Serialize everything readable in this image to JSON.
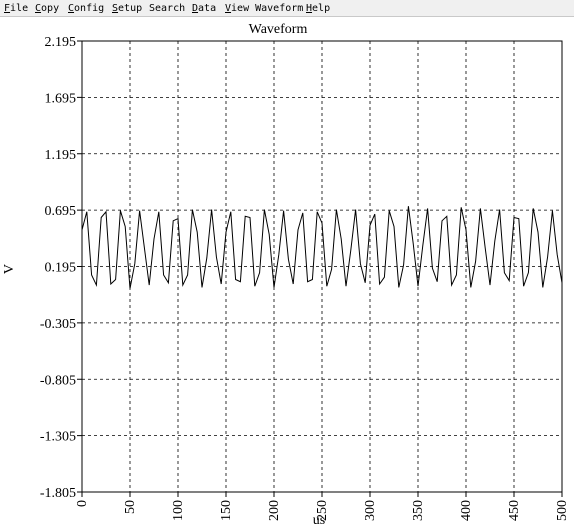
{
  "menu": [
    {
      "mnemonic": "F",
      "rest": "ile"
    },
    {
      "mnemonic": "C",
      "rest": "opy"
    },
    {
      "mnemonic": "C",
      "rest": "onfig",
      "prefix": ""
    },
    {
      "mnemonic": "S",
      "rest": "etup"
    },
    {
      "mnemonic": "",
      "rest": "Search"
    },
    {
      "mnemonic": "D",
      "rest": "ata"
    },
    {
      "mnemonic": "V",
      "rest": "iew Waveform"
    },
    {
      "mnemonic": "H",
      "rest": "elp"
    }
  ],
  "chart_data": {
    "type": "line",
    "title": "Waveform",
    "xlabel": "us",
    "ylabel": "V",
    "xlim": [
      0,
      500
    ],
    "ylim": [
      -1.805,
      2.195
    ],
    "x_ticks": [
      0,
      50,
      100,
      150,
      200,
      250,
      300,
      350,
      400,
      450,
      500
    ],
    "y_ticks": [
      2.195,
      1.695,
      1.195,
      0.695,
      0.195,
      -0.305,
      -0.805,
      -1.305,
      -1.805
    ],
    "y_tick_labels": [
      "2.195",
      "1.695",
      "1.195",
      "0.695",
      "0.195",
      "-0.305",
      "-0.805",
      "-1.305",
      "-1.805"
    ],
    "x_tick_labels": [
      "0",
      "50",
      "100",
      "150",
      "200",
      "250",
      "300",
      "350",
      "400",
      "450",
      "500"
    ],
    "grid": true,
    "series": [
      {
        "color": "#000000",
        "x": [
          0,
          5,
          10,
          15,
          20,
          25,
          30,
          35,
          40,
          45,
          50,
          55,
          60,
          65,
          70,
          75,
          80,
          85,
          90,
          95,
          100,
          105,
          110,
          115,
          120,
          125,
          130,
          135,
          140,
          145,
          150,
          155,
          160,
          165,
          170,
          175,
          180,
          185,
          190,
          195,
          200,
          205,
          210,
          215,
          220,
          225,
          230,
          235,
          240,
          245,
          250,
          255,
          260,
          265,
          270,
          275,
          280,
          285,
          290,
          295,
          300,
          305,
          310,
          315,
          320,
          325,
          330,
          335,
          340,
          345,
          350,
          355,
          360,
          365,
          370,
          375,
          380,
          385,
          390,
          395,
          400,
          405,
          410,
          415,
          420,
          425,
          430,
          435,
          440,
          445,
          450,
          455,
          460,
          465,
          470,
          475,
          480,
          485,
          490,
          495,
          500
        ],
        "values": [
          0.52,
          0.68,
          0.12,
          0.03,
          0.63,
          0.68,
          0.04,
          0.08,
          0.69,
          0.55,
          0.0,
          0.22,
          0.69,
          0.36,
          0.03,
          0.44,
          0.68,
          0.12,
          0.05,
          0.6,
          0.62,
          0.03,
          0.12,
          0.7,
          0.5,
          0.01,
          0.27,
          0.7,
          0.28,
          0.04,
          0.5,
          0.68,
          0.08,
          0.06,
          0.64,
          0.63,
          0.02,
          0.14,
          0.7,
          0.48,
          0.01,
          0.3,
          0.69,
          0.26,
          0.04,
          0.52,
          0.67,
          0.06,
          0.08,
          0.68,
          0.58,
          0.02,
          0.17,
          0.7,
          0.44,
          0.02,
          0.34,
          0.7,
          0.22,
          0.05,
          0.56,
          0.66,
          0.04,
          0.1,
          0.69,
          0.55,
          0.01,
          0.21,
          0.73,
          0.4,
          0.02,
          0.38,
          0.71,
          0.18,
          0.06,
          0.6,
          0.64,
          0.03,
          0.12,
          0.72,
          0.52,
          0.01,
          0.24,
          0.71,
          0.36,
          0.03,
          0.42,
          0.7,
          0.14,
          0.07,
          0.63,
          0.62,
          0.02,
          0.14,
          0.71,
          0.5,
          0.01,
          0.28,
          0.69,
          0.3,
          0.05
        ]
      }
    ]
  }
}
